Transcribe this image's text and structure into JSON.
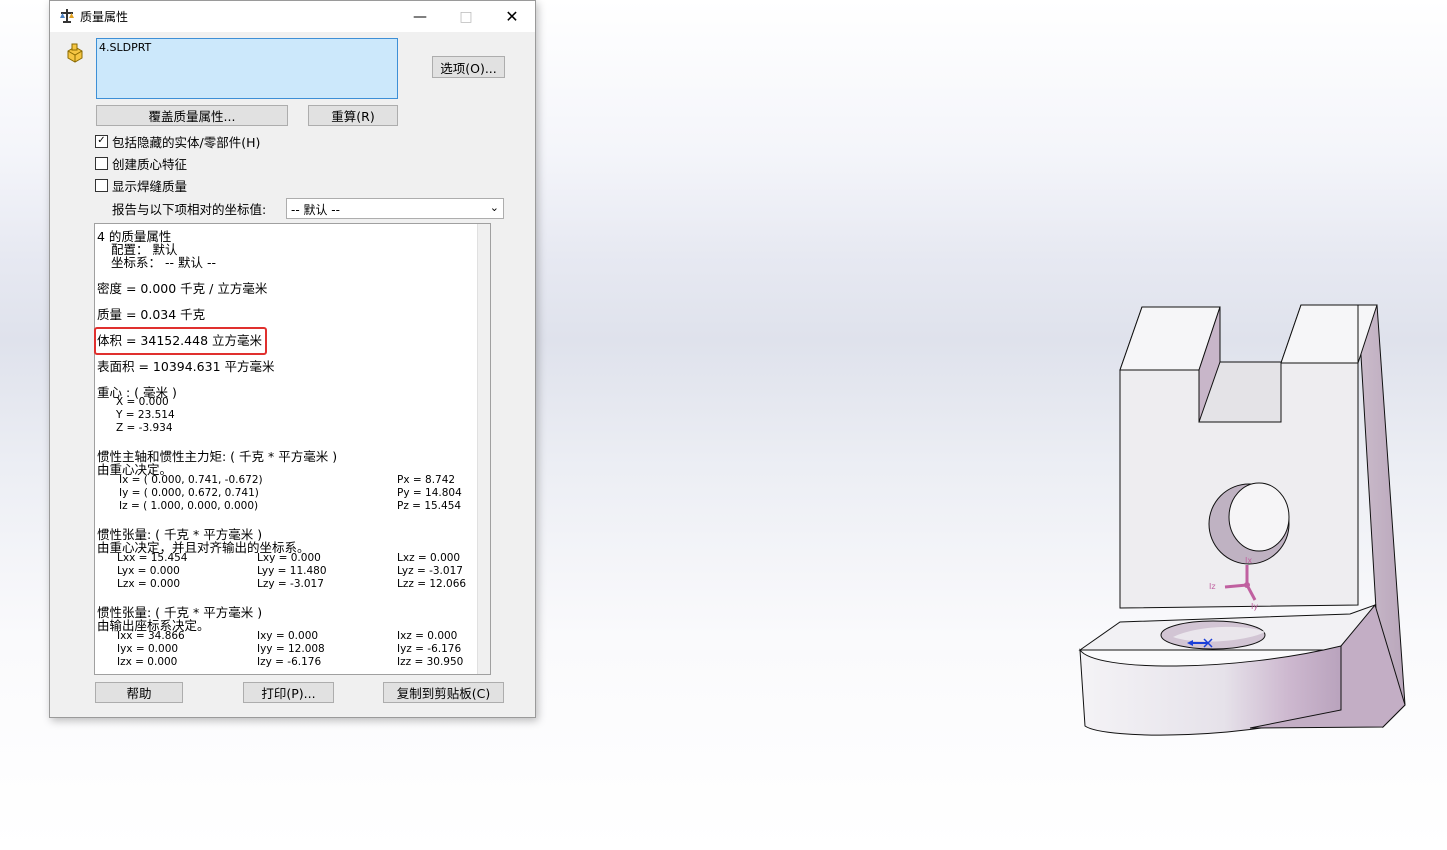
{
  "window": {
    "title": "质量属性"
  },
  "selection": {
    "items": [
      "4.SLDPRT"
    ]
  },
  "buttons": {
    "options": "选项(O)...",
    "override": "覆盖质量属性...",
    "recalc": "重算(R)",
    "help": "帮助",
    "print": "打印(P)...",
    "copy": "复制到剪贴板(C)"
  },
  "options": {
    "include_hidden": {
      "label": "包括隐藏的实体/零部件(H)",
      "checked": true
    },
    "create_com": {
      "label": "创建质心特征",
      "checked": false
    },
    "show_weld": {
      "label": "显示焊缝质量",
      "checked": false
    }
  },
  "coordinate": {
    "label": "报告与以下项相对的坐标值:",
    "value": "-- 默认 --"
  },
  "results": {
    "header": "4 的质量属性",
    "config": "配置： 默认",
    "coordsys": "坐标系： -- 默认 --",
    "density": "密度 = 0.000 千克 / 立方毫米",
    "mass": "质量 = 0.034 千克",
    "volume": "体积 = 34152.448 立方毫米",
    "area": "表面积 = 10394.631  平方毫米",
    "com_title": "重心 : ( 毫米 )",
    "com_x": "X = 0.000",
    "com_y": "Y = 23.514",
    "com_z": "Z = -3.934",
    "principal_title": "惯性主轴和惯性主力矩: ( 千克 *  平方毫米 )",
    "principal_sub": "由重心决定。",
    "ix": "Ix = ( 0.000,  0.741, -0.672)",
    "iy": "Iy = ( 0.000,  0.672,  0.741)",
    "iz": "Iz = ( 1.000,  0.000,  0.000)",
    "px": "Px = 8.742",
    "py": "Py = 14.804",
    "pz": "Pz = 15.454",
    "tensor1_title": "惯性张量: ( 千克 *  平方毫米 )",
    "tensor1_sub": "由重心决定，并且对齐输出的坐标系。",
    "t1": [
      [
        "Lxx = 15.454",
        "Lxy = 0.000",
        "Lxz = 0.000"
      ],
      [
        "Lyx = 0.000",
        "Lyy = 11.480",
        "Lyz = -3.017"
      ],
      [
        "Lzx = 0.000",
        "Lzy = -3.017",
        "Lzz = 12.066"
      ]
    ],
    "tensor2_title": "惯性张量: ( 千克 *  平方毫米 )",
    "tensor2_sub": "由输出座标系决定。",
    "t2": [
      [
        "Ixx = 34.866",
        "Ixy = 0.000",
        "Ixz = 0.000"
      ],
      [
        "Iyx = 0.000",
        "Iyy = 12.008",
        "Iyz = -6.176"
      ],
      [
        "Izx = 0.000",
        "Izy = -6.176",
        "Izz = 30.950"
      ]
    ]
  },
  "model": {
    "triad_labels": [
      "Ix",
      "Iz",
      "Iy"
    ]
  }
}
